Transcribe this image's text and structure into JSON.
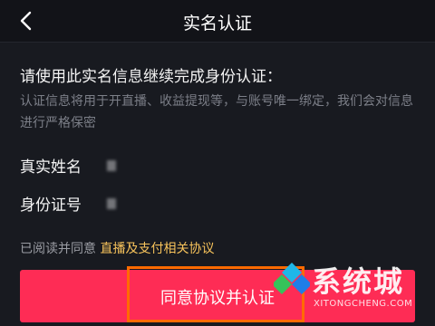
{
  "header": {
    "title": "实名认证"
  },
  "main": {
    "heading": "请使用此实名信息继续完成身份认证：",
    "description": "认证信息将用于开直播、收益提现等，与账号唯一绑定，我们会对信息进行严格保密",
    "fields": {
      "name_label": "真实姓名",
      "id_label": "身份证号"
    }
  },
  "agreement": {
    "prefix": "已阅读并同意",
    "link": "直播及支付相关协议"
  },
  "cta": {
    "label": "同意协议并认证"
  },
  "watermark": {
    "title": "系统城",
    "subtitle": "XITONGCHENG.COM"
  },
  "colors": {
    "background": "#181a20",
    "primary": "#fe2c55",
    "link": "#f7c35b",
    "highlight": "#ff6a00"
  }
}
